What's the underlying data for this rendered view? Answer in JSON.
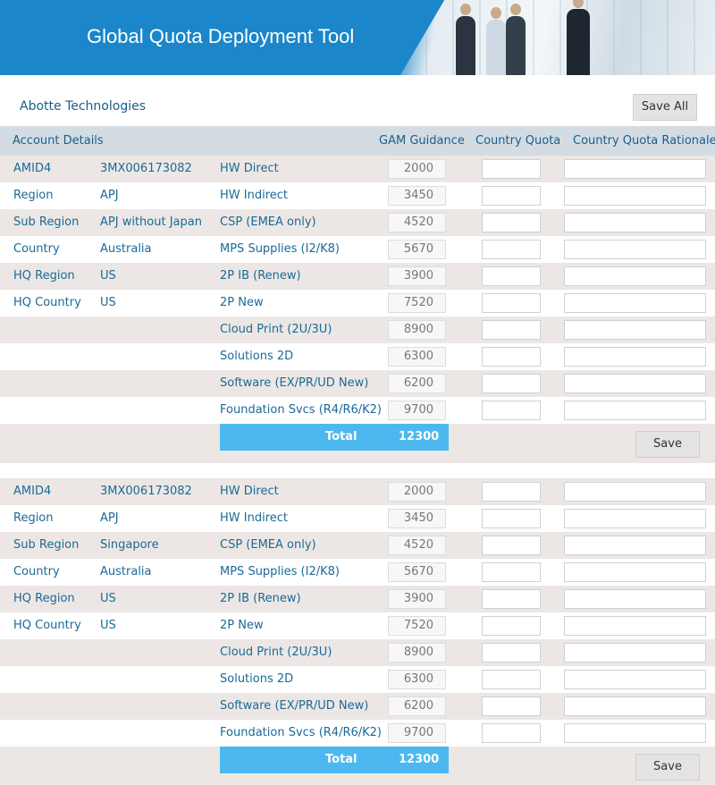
{
  "app": {
    "title": "Global Quota Deployment Tool"
  },
  "company": "Abotte Technologies",
  "save_all_label": "Save All",
  "header": {
    "account_details": "Account Details",
    "gam_guidance": "GAM Guidance",
    "country_quota": "Country Quota",
    "country_quota_rationale": "Country Quota Rationale"
  },
  "sections": [
    {
      "details": [
        {
          "label": "AMID4",
          "value": "3MX006173082"
        },
        {
          "label": "Region",
          "value": "APJ"
        },
        {
          "label": "Sub Region",
          "value": "APJ without Japan"
        },
        {
          "label": "Country",
          "value": "Australia"
        },
        {
          "label": "HQ Region",
          "value": "US"
        },
        {
          "label": "HQ Country",
          "value": "US"
        }
      ],
      "lines": [
        {
          "name": "HW Direct",
          "gam": "2000",
          "quota": "",
          "rationale": ""
        },
        {
          "name": "HW Indirect",
          "gam": "3450",
          "quota": "",
          "rationale": ""
        },
        {
          "name": "CSP (EMEA only)",
          "gam": "4520",
          "quota": "",
          "rationale": ""
        },
        {
          "name": "MPS Supplies (I2/K8)",
          "gam": "5670",
          "quota": "",
          "rationale": ""
        },
        {
          "name": "2P IB (Renew)",
          "gam": "3900",
          "quota": "",
          "rationale": ""
        },
        {
          "name": "2P New",
          "gam": "7520",
          "quota": "",
          "rationale": ""
        },
        {
          "name": "Cloud Print (2U/3U)",
          "gam": "8900",
          "quota": "",
          "rationale": ""
        },
        {
          "name": "Solutions 2D",
          "gam": "6300",
          "quota": "",
          "rationale": ""
        },
        {
          "name": "Software (EX/PR/UD New)",
          "gam": "6200",
          "quota": "",
          "rationale": ""
        },
        {
          "name": "Foundation Svcs (R4/R6/K2)",
          "gam": "9700",
          "quota": "",
          "rationale": ""
        }
      ],
      "total_label": "Total",
      "total_value": "12300",
      "save_label": "Save"
    },
    {
      "details": [
        {
          "label": "AMID4",
          "value": "3MX006173082"
        },
        {
          "label": "Region",
          "value": "APJ"
        },
        {
          "label": "Sub Region",
          "value": "Singapore"
        },
        {
          "label": "Country",
          "value": "Australia"
        },
        {
          "label": "HQ Region",
          "value": "US"
        },
        {
          "label": "HQ Country",
          "value": "US"
        }
      ],
      "lines": [
        {
          "name": "HW Direct",
          "gam": "2000",
          "quota": "",
          "rationale": ""
        },
        {
          "name": "HW Indirect",
          "gam": "3450",
          "quota": "",
          "rationale": ""
        },
        {
          "name": "CSP (EMEA only)",
          "gam": "4520",
          "quota": "",
          "rationale": ""
        },
        {
          "name": "MPS Supplies (I2/K8)",
          "gam": "5670",
          "quota": "",
          "rationale": ""
        },
        {
          "name": "2P IB (Renew)",
          "gam": "3900",
          "quota": "",
          "rationale": ""
        },
        {
          "name": "2P New",
          "gam": "7520",
          "quota": "",
          "rationale": ""
        },
        {
          "name": "Cloud Print (2U/3U)",
          "gam": "8900",
          "quota": "",
          "rationale": ""
        },
        {
          "name": "Solutions 2D",
          "gam": "6300",
          "quota": "",
          "rationale": ""
        },
        {
          "name": "Software (EX/PR/UD New)",
          "gam": "6200",
          "quota": "",
          "rationale": ""
        },
        {
          "name": "Foundation Svcs (R4/R6/K2)",
          "gam": "9700",
          "quota": "",
          "rationale": ""
        }
      ],
      "total_label": "Total",
      "total_value": "12300",
      "save_label": "Save"
    }
  ]
}
